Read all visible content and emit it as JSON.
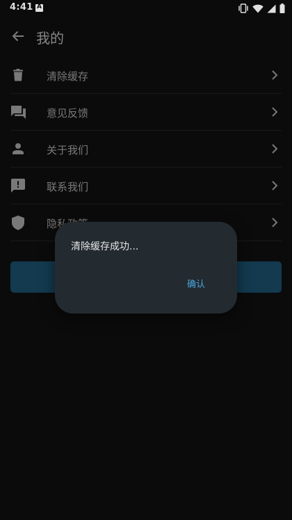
{
  "status_bar": {
    "time": "4:41",
    "icons": [
      "app-notification-icon",
      "vibrate-icon",
      "wifi-icon",
      "signal-icon",
      "battery-icon"
    ]
  },
  "app_bar": {
    "title": "我的",
    "back_icon": "arrow-left-icon"
  },
  "menu": {
    "items": [
      {
        "label": "清除缓存",
        "icon": "trash-icon"
      },
      {
        "label": "意见反馈",
        "icon": "forum-chat-icon"
      },
      {
        "label": "关于我们",
        "icon": "person-icon"
      },
      {
        "label": "联系我们",
        "icon": "feedback-alert-icon"
      },
      {
        "label": "隐私政策",
        "icon": "shield-icon"
      }
    ],
    "chevron_icon": "chevron-right-icon"
  },
  "dialog": {
    "message": "清除缓存成功...",
    "confirm_label": "确认"
  },
  "colors": {
    "background": "#0d0d0d",
    "dialog_background": "#232a30",
    "accent": "#4aa6dd",
    "button_background": "#16425a"
  }
}
